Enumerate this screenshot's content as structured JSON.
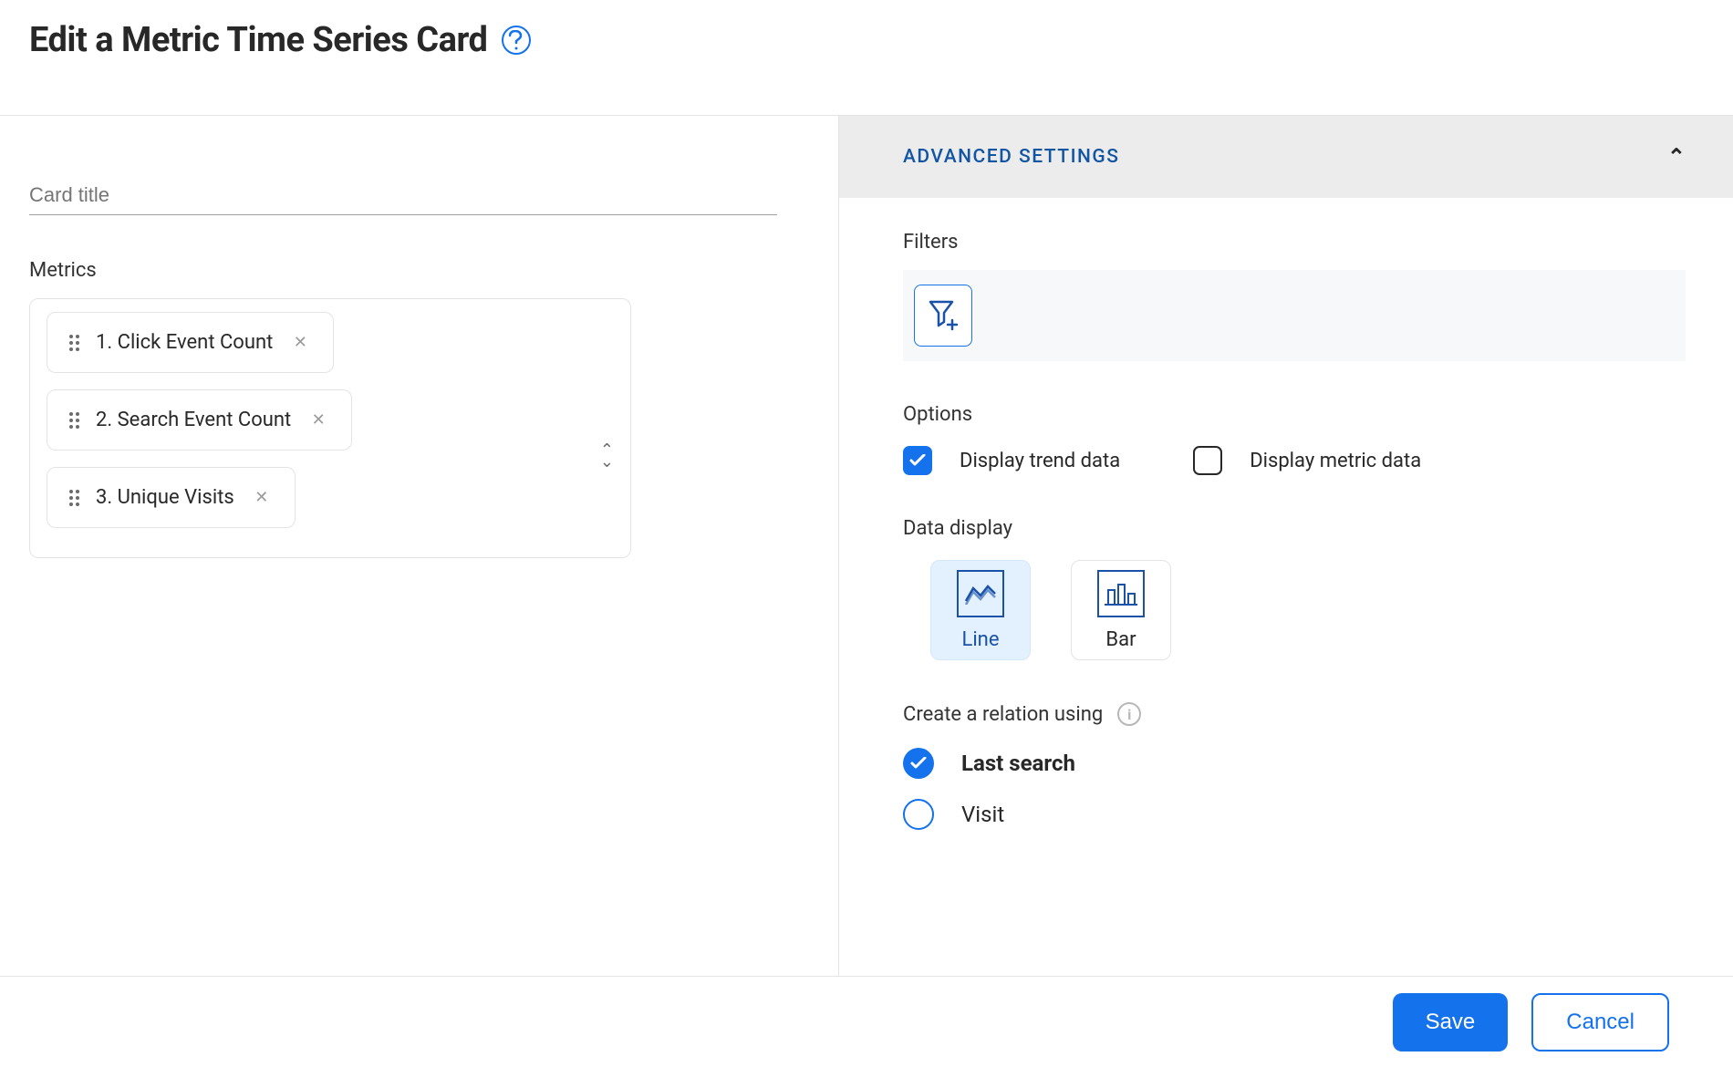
{
  "header": {
    "title": "Edit a Metric Time Series Card",
    "help_icon": "help-icon"
  },
  "card_title": {
    "placeholder": "Card title",
    "value": ""
  },
  "metrics": {
    "label": "Metrics",
    "items": [
      {
        "label": "1. Click Event Count"
      },
      {
        "label": "2. Search Event Count"
      },
      {
        "label": "3. Unique Visits"
      }
    ]
  },
  "advanced": {
    "title": "ADVANCED SETTINGS",
    "expanded": true,
    "filters": {
      "label": "Filters",
      "add_icon": "filter-add-icon"
    },
    "options": {
      "label": "Options",
      "display_trend": {
        "label": "Display trend data",
        "checked": true
      },
      "display_metric": {
        "label": "Display metric data",
        "checked": false
      }
    },
    "data_display": {
      "label": "Data display",
      "choices": [
        {
          "id": "line",
          "label": "Line",
          "selected": true
        },
        {
          "id": "bar",
          "label": "Bar",
          "selected": false
        }
      ]
    },
    "relation": {
      "label": "Create a relation using",
      "info_icon": "info-icon",
      "choices": [
        {
          "label": "Last search",
          "selected": true
        },
        {
          "label": "Visit",
          "selected": false
        }
      ]
    }
  },
  "footer": {
    "save_label": "Save",
    "cancel_label": "Cancel"
  }
}
